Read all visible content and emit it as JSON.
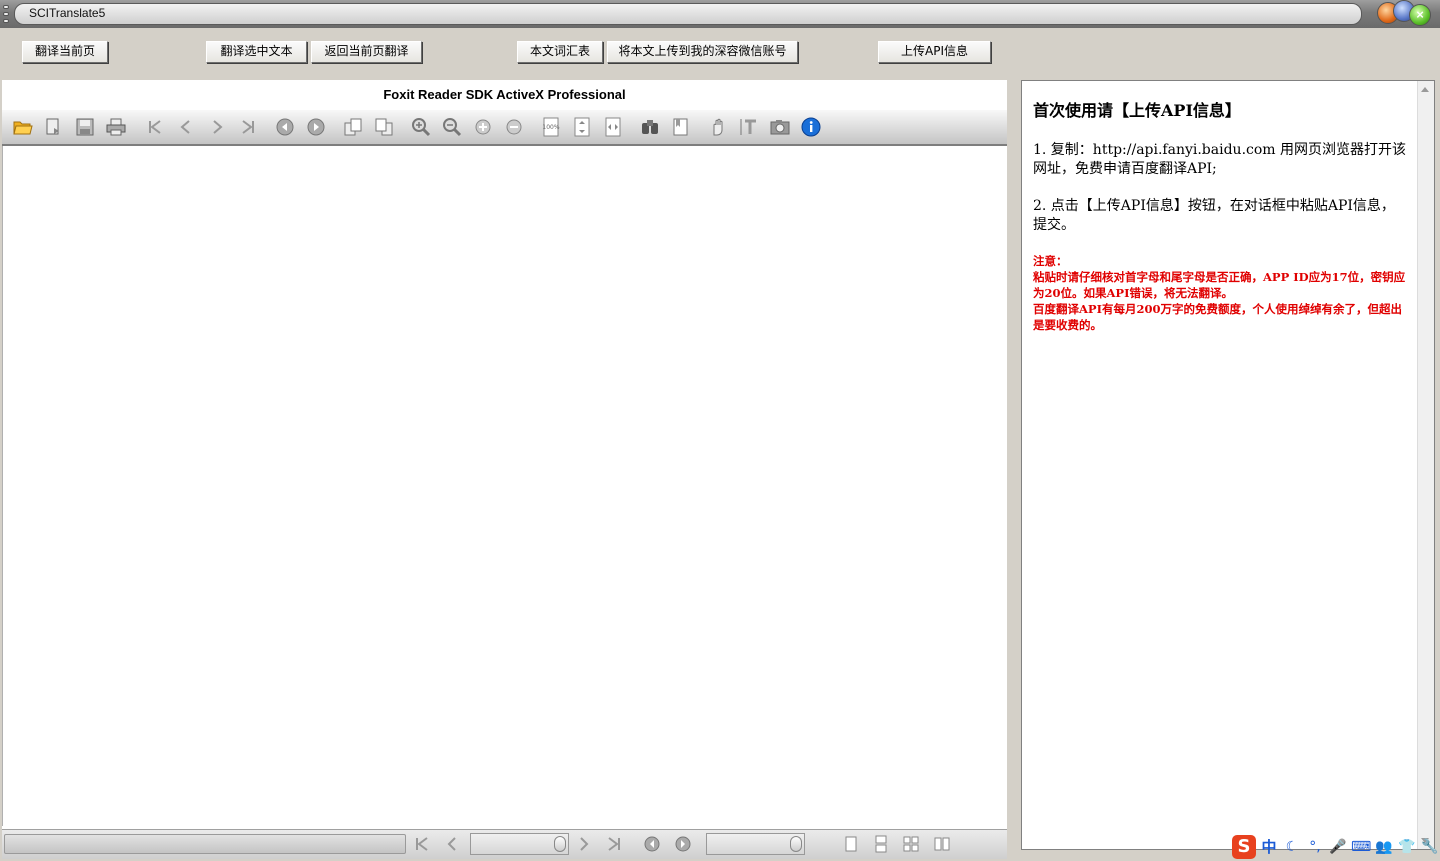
{
  "window": {
    "title": "SCITranslate5"
  },
  "toolbar": {
    "buttons": [
      {
        "label": "翻译当前页"
      },
      {
        "label": "翻译选中文本"
      },
      {
        "label": "返回当前页翻译"
      },
      {
        "label": "本文词汇表"
      },
      {
        "label": "将本文上传到我的深容微信账号"
      },
      {
        "label": "上传API信息"
      }
    ]
  },
  "viewer": {
    "title": "Foxit Reader SDK ActiveX Professional",
    "toolbar_icons": [
      "open-icon",
      "export-icon",
      "save-icon",
      "print-icon",
      "first-page-icon",
      "prev-page-icon",
      "next-page-icon",
      "last-page-icon",
      "back-icon",
      "forward-icon",
      "rotate-left-icon",
      "rotate-right-icon",
      "zoom-in-icon",
      "zoom-out-icon",
      "zoom-in-small-icon",
      "zoom-out-small-icon",
      "actual-size-icon",
      "fit-page-icon",
      "fit-width-icon",
      "find-icon",
      "bookmark-icon",
      "hand-tool-icon",
      "text-select-icon",
      "snapshot-icon",
      "info-icon"
    ],
    "zoom_box_label": "100%"
  },
  "panel": {
    "heading": "首次使用请【上传API信息】",
    "step1": "1. 复制：http://api.fanyi.baidu.com 用网页浏览器打开该网址，免费申请百度翻译API;",
    "step2": "2. 点击【上传API信息】按钮，在对话框中粘贴API信息，提交。",
    "note_title": "注意：",
    "note1": "粘贴时请仔细核对首字母和尾字母是否正确，APP ID应为17位，密钥应为20位。如果API错误，将无法翻译。",
    "note2": "百度翻译API有每月200万字的免费额度，个人使用绰绰有余了，但超出是要收费的。"
  },
  "tray": {
    "ime_logo": "S",
    "ime_mode": "中"
  }
}
